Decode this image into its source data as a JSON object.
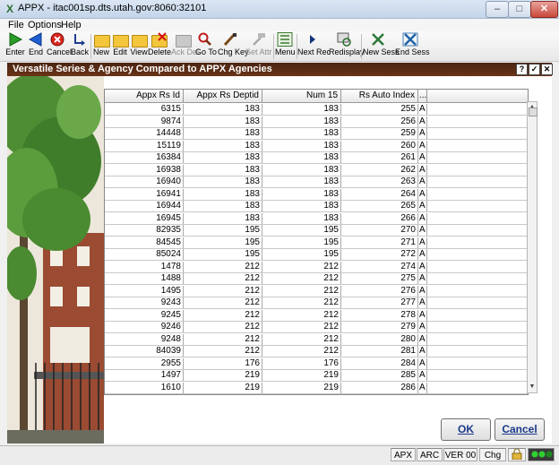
{
  "window": {
    "title": "APPX - itac001sp.dts.utah.gov:8060:32101",
    "app_icon_glyph": "X"
  },
  "menu": [
    "File",
    "Options",
    "Help"
  ],
  "toolbar": [
    {
      "label": "Enter",
      "icon": "enter-arrow-icon",
      "enabled": true
    },
    {
      "label": "End",
      "icon": "end-arrow-icon",
      "enabled": true
    },
    {
      "label": "Cancel",
      "icon": "cancel-circle-icon",
      "enabled": true
    },
    {
      "label": "Back",
      "icon": "back-arrow-icon",
      "enabled": true
    },
    {
      "label": "New",
      "icon": "folder-new-icon",
      "enabled": true
    },
    {
      "label": "Edit",
      "icon": "folder-edit-icon",
      "enabled": true
    },
    {
      "label": "View",
      "icon": "folder-view-icon",
      "enabled": true
    },
    {
      "label": "Delete",
      "icon": "folder-delete-icon",
      "enabled": true
    },
    {
      "label": "Ack Del",
      "icon": "folder-ack-delete-icon",
      "enabled": false
    },
    {
      "label": "Go To",
      "icon": "magnifier-icon",
      "enabled": true
    },
    {
      "label": "Chg Key",
      "icon": "key-brush-icon",
      "enabled": true
    },
    {
      "label": "Set Attr",
      "icon": "hammer-icon",
      "enabled": false
    },
    {
      "label": "Menu",
      "icon": "menu-list-icon",
      "enabled": true
    },
    {
      "label": "Next Rec",
      "icon": "next-record-icon",
      "enabled": true
    },
    {
      "label": "Redisplay",
      "icon": "redisplay-icon",
      "enabled": true
    },
    {
      "label": "New Sess",
      "icon": "new-session-icon",
      "enabled": true
    },
    {
      "label": "End Sess",
      "icon": "end-session-icon",
      "enabled": true
    }
  ],
  "form": {
    "title": "Versatile Series & Agency Compared to APPX Agencies",
    "title_buttons": [
      "?",
      "✓",
      "✕"
    ]
  },
  "grid": {
    "columns": [
      "Appx Rs Id",
      "Appx Rs Deptid",
      "Num 15",
      "Rs Auto Index",
      "..."
    ],
    "rows": [
      [
        "6315",
        "183",
        "183",
        "255",
        "A"
      ],
      [
        "9874",
        "183",
        "183",
        "256",
        "A"
      ],
      [
        "14448",
        "183",
        "183",
        "259",
        "A"
      ],
      [
        "15119",
        "183",
        "183",
        "260",
        "A"
      ],
      [
        "16384",
        "183",
        "183",
        "261",
        "A"
      ],
      [
        "16938",
        "183",
        "183",
        "262",
        "A"
      ],
      [
        "16940",
        "183",
        "183",
        "263",
        "A"
      ],
      [
        "16941",
        "183",
        "183",
        "264",
        "A"
      ],
      [
        "16944",
        "183",
        "183",
        "265",
        "A"
      ],
      [
        "16945",
        "183",
        "183",
        "266",
        "A"
      ],
      [
        "82935",
        "195",
        "195",
        "270",
        "A"
      ],
      [
        "84545",
        "195",
        "195",
        "271",
        "A"
      ],
      [
        "85024",
        "195",
        "195",
        "272",
        "A"
      ],
      [
        "1478",
        "212",
        "212",
        "274",
        "A"
      ],
      [
        "1488",
        "212",
        "212",
        "275",
        "A"
      ],
      [
        "1495",
        "212",
        "212",
        "276",
        "A"
      ],
      [
        "9243",
        "212",
        "212",
        "277",
        "A"
      ],
      [
        "9245",
        "212",
        "212",
        "278",
        "A"
      ],
      [
        "9246",
        "212",
        "212",
        "279",
        "A"
      ],
      [
        "9248",
        "212",
        "212",
        "280",
        "A"
      ],
      [
        "84039",
        "212",
        "212",
        "281",
        "A"
      ],
      [
        "2955",
        "176",
        "176",
        "284",
        "A"
      ],
      [
        "1497",
        "219",
        "219",
        "285",
        "A"
      ],
      [
        "1610",
        "219",
        "219",
        "286",
        "A"
      ]
    ]
  },
  "buttons": {
    "ok": "OK",
    "cancel": "Cancel"
  },
  "status": [
    "APX",
    "ARC",
    "VER 00",
    "Chg"
  ],
  "colors": {
    "form_bar": "#5a2c14",
    "accent_blue": "#1b3a8a"
  }
}
